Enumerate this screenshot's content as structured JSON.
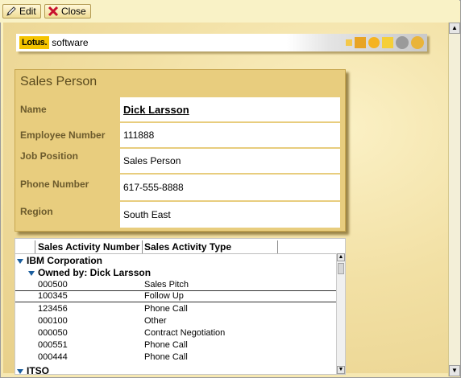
{
  "toolbar": {
    "edit_label": "Edit",
    "close_label": "Close"
  },
  "banner": {
    "brand": "Lotus.",
    "product": "software"
  },
  "form": {
    "title": "Sales Person",
    "fields": [
      {
        "label": "Name",
        "value": "Dick Larsson"
      },
      {
        "label": "Employee Number",
        "value": "111888"
      },
      {
        "label": "Job Position",
        "value": "Sales Person"
      },
      {
        "label": "Phone Number",
        "value": "617-555-8888"
      },
      {
        "label": "Region",
        "value": "South East"
      }
    ]
  },
  "view": {
    "columns": [
      "Sales Activity Number",
      "Sales Activity Type"
    ],
    "category": "IBM Corporation",
    "subcategory": "Owned by: Dick Larsson",
    "rows": [
      {
        "number": "000500",
        "type": "Sales Pitch"
      },
      {
        "number": "100345",
        "type": "Follow Up"
      },
      {
        "number": "123456",
        "type": "Phone Call"
      },
      {
        "number": "000100",
        "type": "Other"
      },
      {
        "number": "000050",
        "type": "Contract Negotiation"
      },
      {
        "number": "000551",
        "type": "Phone Call"
      },
      {
        "number": "000444",
        "type": "Phone Call"
      }
    ],
    "next_category": "ITSO"
  },
  "colors": {
    "card_bg": "#e8cd7e",
    "label_text": "#6b5a2c",
    "twistie": "#1b5e9e",
    "lotus_yellow": "#f5c400"
  }
}
